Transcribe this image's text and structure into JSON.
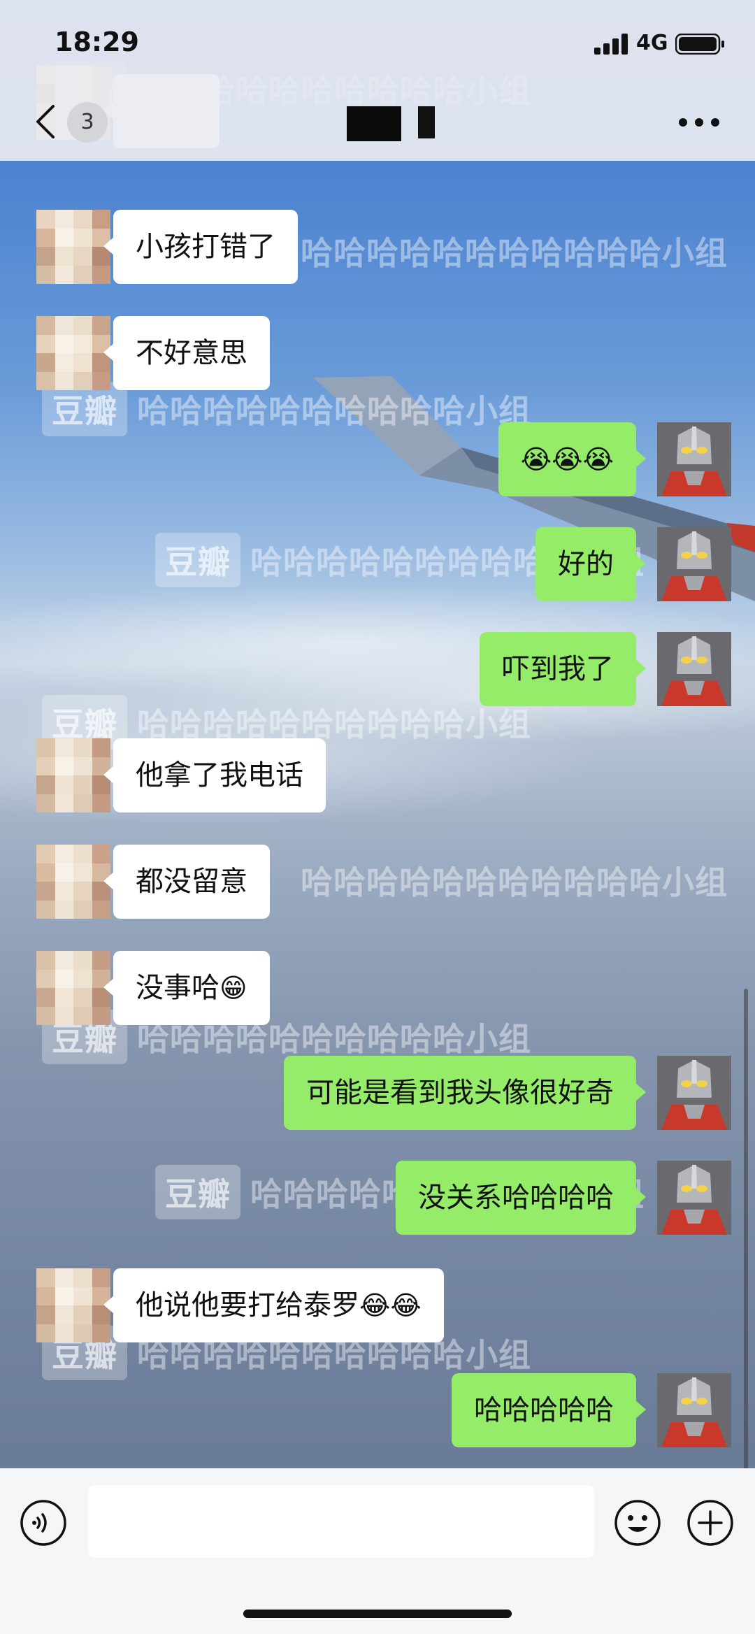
{
  "status_bar": {
    "time": "18:29",
    "network": "4G",
    "icons": [
      "signal-icon",
      "battery-icon"
    ]
  },
  "nav": {
    "unread_count": "3",
    "icons": [
      "back-arrow-icon",
      "more-dots-icon"
    ]
  },
  "watermark": {
    "logo": "豆瓣",
    "text": "哈哈哈哈哈哈哈哈哈哈小组",
    "text_long": "哈哈哈哈哈哈哈哈哈哈哈小组"
  },
  "messages": [
    {
      "side": "left",
      "text": "小孩打错了"
    },
    {
      "side": "left",
      "text": "不好意思"
    },
    {
      "side": "right",
      "text": "",
      "emoji": "😭😭😭"
    },
    {
      "side": "right",
      "text": "好的"
    },
    {
      "side": "right",
      "text": "吓到我了"
    },
    {
      "side": "left",
      "text": "他拿了我电话"
    },
    {
      "side": "left",
      "text": "都没留意"
    },
    {
      "side": "left",
      "text": "没事哈",
      "emoji": "😁"
    },
    {
      "side": "right",
      "text": "可能是看到我头像很好奇"
    },
    {
      "side": "right",
      "text": "没关系哈哈哈哈"
    },
    {
      "side": "left",
      "text": "他说他要打给泰罗",
      "emoji": "😂😂"
    },
    {
      "side": "right",
      "text": "哈哈哈哈哈"
    }
  ],
  "input": {
    "placeholder": "",
    "icons": [
      "voice-icon",
      "emoji-icon",
      "plus-icon"
    ]
  },
  "colors": {
    "bubble_mine": "#95ec69",
    "bubble_theirs": "#ffffff",
    "header_bg": "#eaecf1"
  }
}
